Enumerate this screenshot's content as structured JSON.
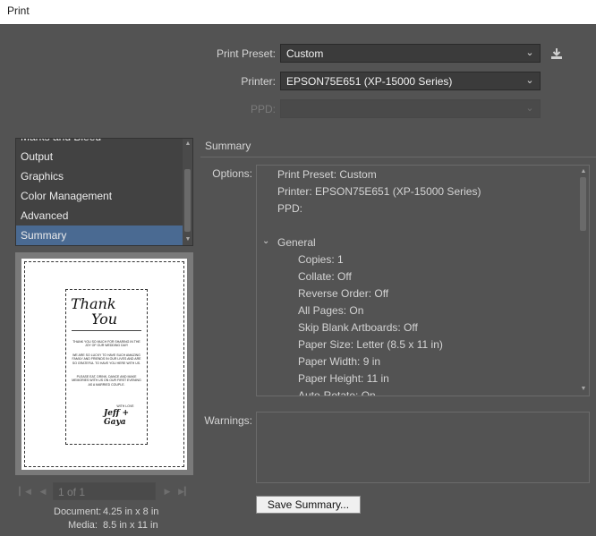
{
  "window": {
    "title": "Print"
  },
  "top": {
    "preset_label": "Print Preset:",
    "preset_value": "Custom",
    "printer_label": "Printer:",
    "printer_value": "EPSON75E651 (XP-15000 Series)",
    "ppd_label": "PPD:",
    "ppd_value": "",
    "save_preset_icon": "download-icon"
  },
  "sidebar": {
    "items": [
      {
        "label": "Marks and Bleed"
      },
      {
        "label": "Output"
      },
      {
        "label": "Graphics"
      },
      {
        "label": "Color Management"
      },
      {
        "label": "Advanced"
      },
      {
        "label": "Summary"
      }
    ],
    "selected": "Summary"
  },
  "preview_art": {
    "title1": "Thank",
    "title2": "You",
    "para1": "THANK YOU SO MUCH FOR SHARING IN THE JOY OF OUR WEDDING DAY!",
    "para2": "WE ARE SO LUCKY TO HAVE SUCH AMAZING FAMILY AND FRIENDS IN OUR LIVES AND ARE SO GRATEFUL TO HAVE YOU HERE WITH US.",
    "para3": "PLEASE EAT, DRINK, DANCE AND MAKE MEMORIES WITH US ON OUR FIRST EVENING AS A MARRIED COUPLE.",
    "withlove": "WITH LOVE",
    "signature": "Jeff + Gaya"
  },
  "pager": {
    "page_text": "1 of 1"
  },
  "doc_info": {
    "document_label": "Document:",
    "document_value": "4.25 in x 8 in",
    "media_label": "Media:",
    "media_value": "8.5 in x 11 in"
  },
  "summary": {
    "section_title": "Summary",
    "options_label": "Options:",
    "lines": [
      {
        "text": "Print Preset: Custom"
      },
      {
        "text": "Printer: EPSON75E651 (XP-15000 Series)"
      },
      {
        "text": "PPD:"
      },
      {
        "text": "General"
      },
      {
        "text": "Copies: 1"
      },
      {
        "text": "Collate: Off"
      },
      {
        "text": "Reverse Order: Off"
      },
      {
        "text": "All Pages: On"
      },
      {
        "text": "Skip Blank Artboards: Off"
      },
      {
        "text": "Paper Size: Letter (8.5 x 11 in)"
      },
      {
        "text": "Paper Width: 9 in"
      },
      {
        "text": "Paper Height: 11 in"
      },
      {
        "text": "Auto-Rotate: On"
      }
    ],
    "warnings_label": "Warnings:",
    "save_button": "Save Summary..."
  }
}
